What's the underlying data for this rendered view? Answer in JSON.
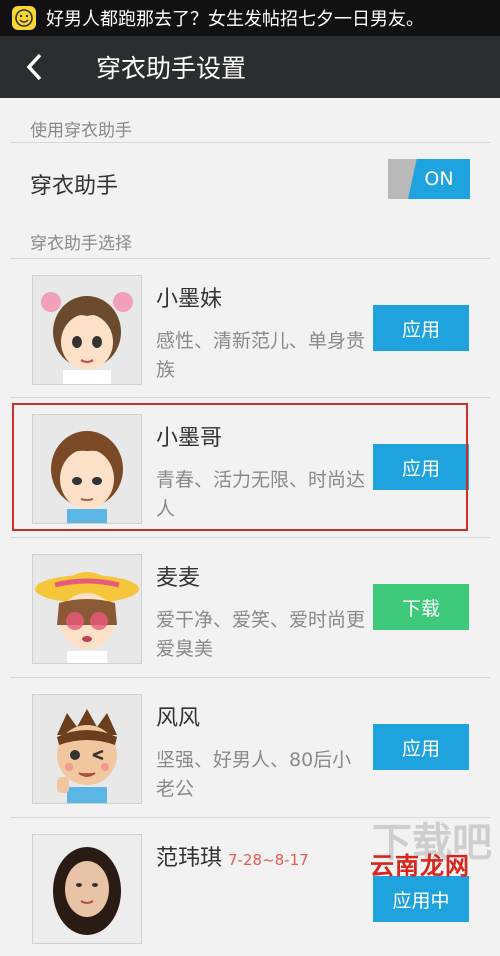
{
  "status_bar": {
    "notification_text": "好男人都跑那去了？女生发帖招七夕一日男友。"
  },
  "header": {
    "title": "穿衣助手设置"
  },
  "sections": {
    "enable_label": "使用穿衣助手",
    "choose_label": "穿衣助手选择"
  },
  "toggle": {
    "label": "穿衣助手",
    "state_text": "ON"
  },
  "items": [
    {
      "name": "小墨妹",
      "date": "",
      "desc": "感性、清新范儿、单身贵族",
      "button": "应用",
      "button_color": "#1fa3de"
    },
    {
      "name": "小墨哥",
      "date": "",
      "desc": "青春、活力无限、时尚达人",
      "button": "应用",
      "button_color": "#1fa3de"
    },
    {
      "name": "麦麦",
      "date": "",
      "desc": "爱干净、爱笑、爱时尚更爱臭美",
      "button": "下载",
      "button_color": "#3ec97a"
    },
    {
      "name": "风风",
      "date": "",
      "desc": "坚强、好男人、80后小老公",
      "button": "应用",
      "button_color": "#1fa3de"
    },
    {
      "name": "范玮琪",
      "date": "7-28~8-17",
      "desc": "",
      "button": "应用中",
      "button_color": "#1fa3de"
    }
  ],
  "watermark": {
    "text": "云南龙网",
    "bg_text": "下载吧"
  }
}
